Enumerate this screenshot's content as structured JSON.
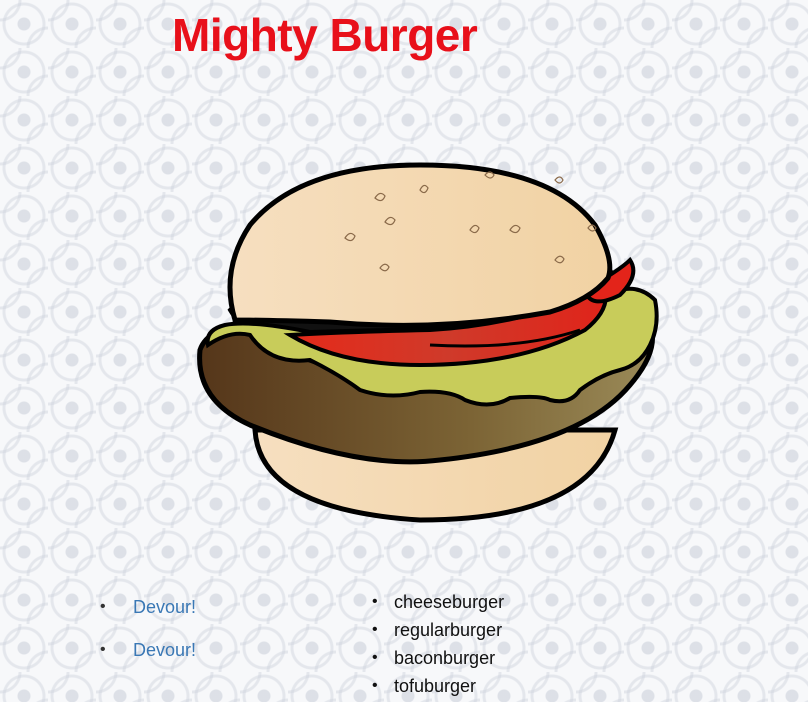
{
  "page": {
    "title": "Mighty Burger",
    "title_color": "#e8101a"
  },
  "image": {
    "icon": "hamburger-illustration"
  },
  "devour_list": {
    "items": [
      {
        "label": "Devour!"
      },
      {
        "label": "Devour!"
      }
    ],
    "link_color": "#3a78b5"
  },
  "burger_list": {
    "items": [
      {
        "label": "cheeseburger"
      },
      {
        "label": "regularburger"
      },
      {
        "label": "baconburger"
      },
      {
        "label": "tofuburger"
      }
    ]
  },
  "bullet": "•"
}
